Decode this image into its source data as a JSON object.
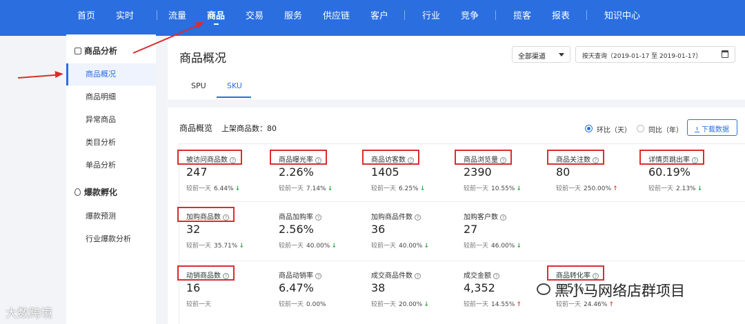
{
  "nav": {
    "items": [
      {
        "label": "首页",
        "active": false
      },
      {
        "label": "实时",
        "active": false
      },
      {
        "label": "流量",
        "active": false
      },
      {
        "label": "商品",
        "active": true
      },
      {
        "label": "交易",
        "active": false
      },
      {
        "label": "服务",
        "active": false
      },
      {
        "label": "供应链",
        "active": false
      },
      {
        "label": "客户",
        "active": false
      },
      {
        "label": "行业",
        "active": false
      },
      {
        "label": "竞争",
        "active": false
      },
      {
        "label": "揽客",
        "active": false
      },
      {
        "label": "报表",
        "active": false
      },
      {
        "label": "知识中心",
        "active": false
      }
    ]
  },
  "sidebar": {
    "groups": [
      {
        "title": "商品分析",
        "icon": "bag-icon",
        "items": [
          "商品概况",
          "商品明细",
          "异常商品",
          "类目分析",
          "单品分析"
        ]
      },
      {
        "title": "爆款孵化",
        "icon": "flame-icon",
        "items": [
          "爆款预测",
          "行业爆款分析"
        ]
      }
    ],
    "active_item": "商品概况"
  },
  "header": {
    "title": "商品概况",
    "channel": "全部渠道",
    "date_range": "按天查询（2019-01-17 至 2019-01-17）",
    "tabs": [
      "SPU",
      "SKU"
    ],
    "active_tab": "SKU"
  },
  "overview": {
    "title": "商品概览",
    "count_label": "上架商品数：80",
    "radio_options": [
      "环比（天）",
      "同比（年）"
    ],
    "radio_selected": "环比（天）",
    "download_label": "下载数据"
  },
  "compare_label": "较前一天",
  "metrics": [
    [
      {
        "label": "被访问商品数",
        "value": "247",
        "pct": "6.44%",
        "dir": "down",
        "highlight": true
      },
      {
        "label": "商品曝光率",
        "value": "2.26%",
        "pct": "7.14%",
        "dir": "down",
        "highlight": true
      },
      {
        "label": "商品访客数",
        "value": "1405",
        "pct": "6.25%",
        "dir": "down",
        "highlight": true
      },
      {
        "label": "商品浏览量",
        "value": "2390",
        "pct": "10.55%",
        "dir": "down",
        "highlight": true
      },
      {
        "label": "商品关注数",
        "value": "80",
        "pct": "250.00%",
        "dir": "up",
        "highlight": true
      },
      {
        "label": "详情页跳出率",
        "value": "60.19%",
        "pct": "2.13%",
        "dir": "down",
        "highlight": true
      }
    ],
    [
      {
        "label": "加购商品数",
        "value": "32",
        "pct": "35.71%",
        "dir": "down",
        "highlight": true
      },
      {
        "label": "商品加购率",
        "value": "2.56%",
        "pct": "40.00%",
        "dir": "down",
        "highlight": false
      },
      {
        "label": "加购商品件数",
        "value": "36",
        "pct": "40.00%",
        "dir": "down",
        "highlight": false
      },
      {
        "label": "加购客户数",
        "value": "27",
        "pct": "46.00%",
        "dir": "down",
        "highlight": false
      }
    ],
    [
      {
        "label": "动销商品数",
        "value": "16",
        "pct": "",
        "dir": "none",
        "highlight": true
      },
      {
        "label": "商品动销率",
        "value": "6.47%",
        "pct": "0.00%",
        "dir": "none",
        "highlight": false
      },
      {
        "label": "成交商品件数",
        "value": "38",
        "pct": "20.00%",
        "dir": "down",
        "highlight": false
      },
      {
        "label": "成交金额",
        "value": "4,352",
        "pct": "14.55%",
        "dir": "up",
        "highlight": false
      },
      {
        "label": "商品转化率",
        "value": "3.5%",
        "pct": "24.46%",
        "dir": "up",
        "highlight": true
      }
    ]
  ],
  "watermarks": {
    "left": "大数跨境",
    "right": "黑小马网络店群项目"
  },
  "colors": {
    "brand": "#2a6ee0",
    "annotation": "#dc2c2c",
    "down": "#2eaa44",
    "up": "#e34a3a"
  }
}
